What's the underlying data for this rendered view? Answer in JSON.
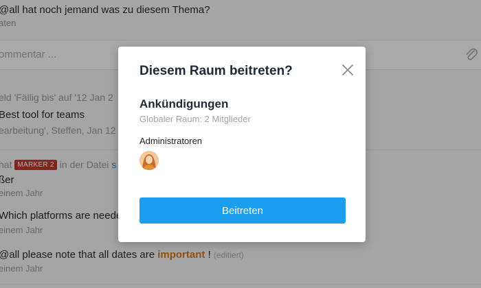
{
  "feed": {
    "msg1": {
      "text": "@all hat noch jemand was zu diesem Thema?",
      "sub": "aten"
    },
    "comment": {
      "placeholder": "ommentar ..."
    },
    "msg2": {
      "line1": "eld 'Fällig bis' auf '12 Jan 2",
      "line2": "Best tool for teams",
      "line3": "earbeitung', Steffen, Jan 12"
    },
    "msg3": {
      "prefix": "hat",
      "marker": "MARKER 2",
      "middle": "in der Datei",
      "link": "s",
      "line2": "ßer",
      "sub": "einem Jahr"
    },
    "msg4": {
      "text": "Which platforms are neede",
      "sub": "einem Jahr"
    },
    "msg5": {
      "text_before": "@all please note that all dates are",
      "important": "important",
      "text_after": "!",
      "edited": "(editiert)",
      "sub": "einem Jahr"
    }
  },
  "modal": {
    "title": "Diesem Raum beitreten?",
    "room_name": "Ankündigungen",
    "room_meta": "Globaler Raum: 2 Mitglieder",
    "admins_label": "Administratoren",
    "join_button": "Beitreten"
  },
  "colors": {
    "accent": "#1a9ff0",
    "marker": "#c0392b",
    "important": "#d9731b",
    "link": "#2a8fd8"
  },
  "icons": {
    "close": "close-icon",
    "attachment": "paperclip-icon",
    "avatar": "admin-avatar"
  }
}
